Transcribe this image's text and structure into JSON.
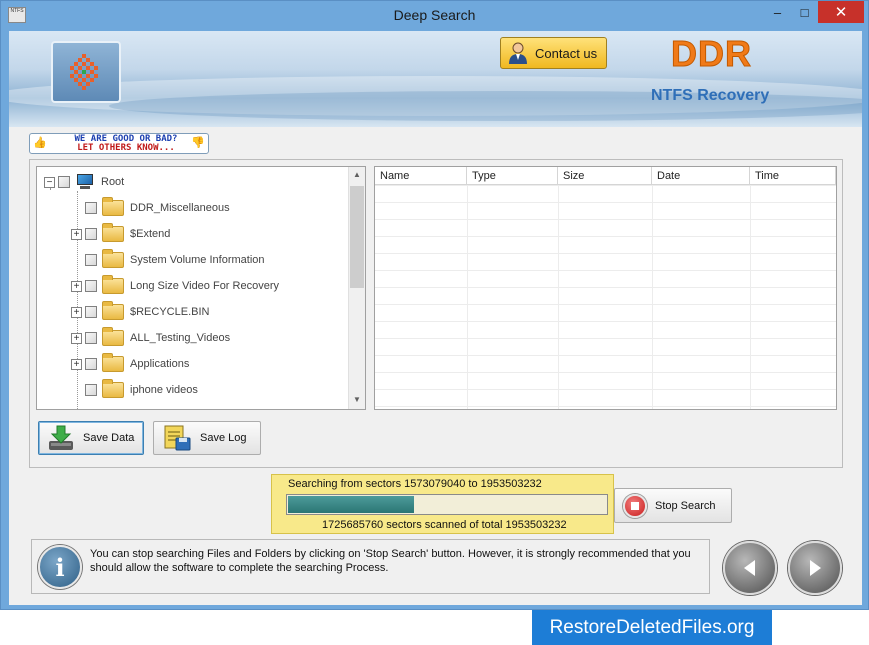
{
  "window": {
    "title": "Deep Search",
    "app_icon_text": "NTFS",
    "controls": {
      "minimize": "–",
      "maximize": "□",
      "close": "✕"
    }
  },
  "header": {
    "contact_label": "Contact us",
    "brand": "DDR",
    "product": "NTFS Recovery",
    "feedback_line1": "WE ARE GOOD OR BAD?",
    "feedback_line2": "LET OTHERS KNOW..."
  },
  "tree": {
    "root": "Root",
    "items": [
      {
        "label": "DDR_Miscellaneous",
        "expandable": false
      },
      {
        "label": "$Extend",
        "expandable": true
      },
      {
        "label": "System Volume Information",
        "expandable": false
      },
      {
        "label": "Long Size Video For Recovery",
        "expandable": true
      },
      {
        "label": "$RECYCLE.BIN",
        "expandable": true
      },
      {
        "label": "ALL_Testing_Videos",
        "expandable": true
      },
      {
        "label": "Applications",
        "expandable": true
      },
      {
        "label": "iphone videos",
        "expandable": false
      }
    ]
  },
  "file_list": {
    "columns": [
      "Name",
      "Type",
      "Size",
      "Date",
      "Time"
    ]
  },
  "buttons": {
    "save_data": "Save Data",
    "save_log": "Save Log",
    "stop_search": "Stop Search"
  },
  "progress": {
    "status_line": "Searching from sectors  1573079040 to 1953503232",
    "scanned_line": "1725685760  sectors scanned of total 1953503232",
    "fraction": 0.4
  },
  "info": {
    "message": "You can stop searching Files and Folders by clicking on 'Stop Search' button. However, it is strongly recommended that you should allow the software to complete the searching Process."
  },
  "footer": {
    "site": "RestoreDeletedFiles.org"
  }
}
